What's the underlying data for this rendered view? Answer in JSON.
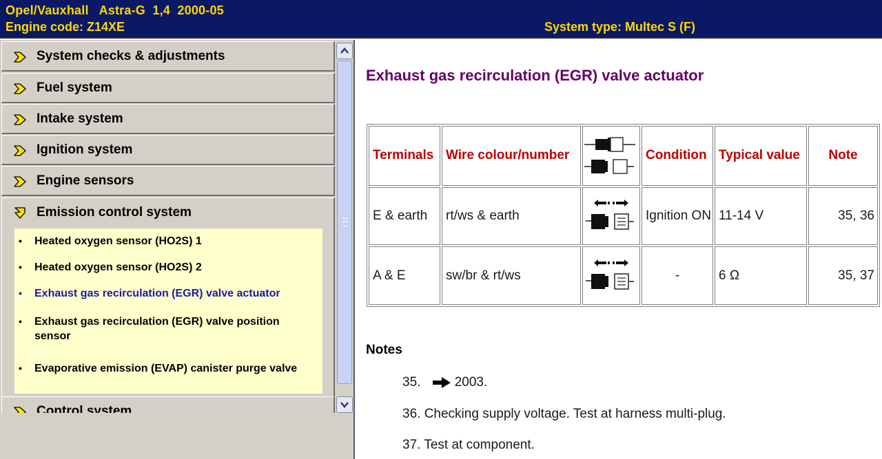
{
  "header": {
    "vehicle": "Opel/Vauxhall   Astra-G  1,4  2000-05",
    "engine_code": "Engine code: Z14XE",
    "system_type": "System type: Multec S (F)"
  },
  "sidebar": {
    "items": [
      {
        "label": "System checks & adjustments",
        "icon": "arrow-right-icon"
      },
      {
        "label": "Fuel system",
        "icon": "arrow-right-icon"
      },
      {
        "label": "Intake system",
        "icon": "arrow-right-icon"
      },
      {
        "label": "Ignition system",
        "icon": "arrow-right-icon"
      },
      {
        "label": "Engine sensors",
        "icon": "arrow-right-icon"
      },
      {
        "label": "Emission control system",
        "icon": "arrow-down-icon"
      },
      {
        "label": "Control system",
        "icon": "arrow-right-icon"
      }
    ],
    "subitems": [
      {
        "bullet": "•",
        "label": "Heated oxygen sensor (HO2S) 1"
      },
      {
        "bullet": "•",
        "label": "Heated oxygen sensor (HO2S) 2"
      },
      {
        "bullet": "•",
        "label": "Exhaust gas recirculation (EGR) valve actuator"
      },
      {
        "bullet": "•",
        "label": "Exhaust gas recirculation (EGR) valve position sensor"
      },
      {
        "bullet": "•",
        "label": "Evaporative emission (EVAP) canister purge valve"
      }
    ]
  },
  "main": {
    "title": "Exhaust gas recirculation (EGR) valve actuator",
    "table": {
      "headers": [
        "Terminals",
        "Wire colour/number",
        "",
        "Condition",
        "Typical value",
        "Note"
      ],
      "rows": [
        {
          "terminals": "E & earth",
          "wire": "rt/ws & earth",
          "condition": "Ignition ON",
          "value": "11-14 V",
          "note": "35, 36"
        },
        {
          "terminals": "A & E",
          "wire": "sw/br & rt/ws",
          "condition": "-",
          "value": "6 Ω",
          "note": "35, 37"
        }
      ]
    },
    "notes_title": "Notes",
    "notes": [
      {
        "number": "35.",
        "text": "2003."
      },
      {
        "number": "36.",
        "text": "Checking supply voltage. Test at harness multi-plug."
      },
      {
        "number": "37.",
        "text": "Test at component."
      }
    ]
  },
  "colors": {
    "header_bg": "#0a1866",
    "header_text": "#ffd800",
    "title": "#660066",
    "table_header": "#c00000",
    "active_link": "#1a1aa8",
    "submenu_bg": "#ffffcc",
    "sidebar_bg": "#d4d0c8"
  }
}
